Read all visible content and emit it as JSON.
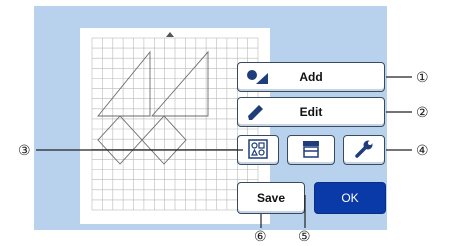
{
  "buttons": {
    "add": "Add",
    "edit": "Edit",
    "save": "Save",
    "ok": "OK"
  },
  "icons": {
    "add": "shapes-icon",
    "edit": "pencil-icon",
    "layout": "arrange-icon",
    "mat": "mat-scan-icon",
    "settings": "wrench-icon"
  },
  "callouts": [
    "①",
    "②",
    "③",
    "④",
    "⑤",
    "⑥"
  ],
  "colors": {
    "panel": "#b8d2ee",
    "accent": "#0a3aa8",
    "icon": "#1f3d7a"
  }
}
